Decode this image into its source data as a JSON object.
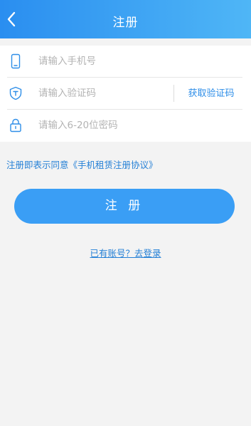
{
  "header": {
    "title": "注册",
    "back_icon": "chevron-left-icon",
    "gradient_from": "#2a8ef0",
    "gradient_to": "#4fb6f6"
  },
  "form": {
    "phone": {
      "placeholder": "请输入手机号",
      "value": "",
      "icon": "phone-icon"
    },
    "code": {
      "placeholder": "请输入验证码",
      "value": "",
      "icon": "shield-icon",
      "button_label": "获取验证码"
    },
    "password": {
      "placeholder": "请输入6-20位密码",
      "value": "",
      "icon": "lock-icon"
    }
  },
  "agreement": {
    "prefix": "注册即表示同意",
    "link_text": "《手机租赁注册协议》"
  },
  "submit_label": "注 册",
  "login_link": "已有账号？去登录",
  "colors": {
    "accent": "#3a9ef5",
    "link": "#2580d6",
    "background": "#f3f3f3"
  }
}
